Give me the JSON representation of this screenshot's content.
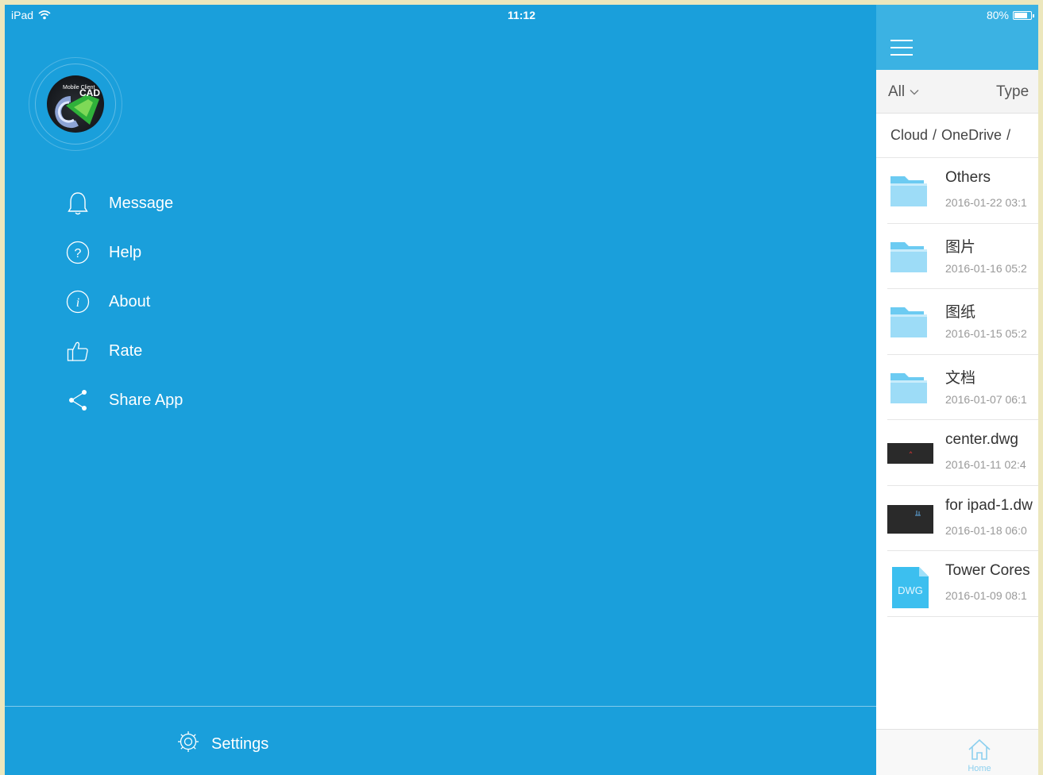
{
  "status_bar": {
    "device": "iPad",
    "time": "11:12",
    "battery": "80%",
    "battery_level": 0.8
  },
  "app_logo": {
    "top_text": "Mobile Client",
    "cad_text": "CAD"
  },
  "menu": {
    "items": [
      {
        "label": "Message",
        "icon": "bell-icon"
      },
      {
        "label": "Help",
        "icon": "help-icon"
      },
      {
        "label": "About",
        "icon": "info-icon"
      },
      {
        "label": "Rate",
        "icon": "thumbs-up-icon"
      },
      {
        "label": "Share App",
        "icon": "share-icon"
      }
    ]
  },
  "settings": {
    "label": "Settings",
    "icon": "gear-icon"
  },
  "panel": {
    "filter": {
      "all_label": "All",
      "type_label": "Type"
    },
    "breadcrumb": [
      "Cloud",
      "OneDrive"
    ],
    "files": [
      {
        "name": "Others",
        "date": "2016-01-22 03:1",
        "kind": "folder"
      },
      {
        "name": "图片",
        "date": "2016-01-16 05:2",
        "kind": "folder"
      },
      {
        "name": "图纸",
        "date": "2016-01-15 05:2",
        "kind": "folder"
      },
      {
        "name": "文档",
        "date": "2016-01-07 06:1",
        "kind": "folder"
      },
      {
        "name": "center.dwg",
        "date": "2016-01-11 02:4",
        "kind": "dwg-preview"
      },
      {
        "name": "for ipad-1.dw",
        "date": "2016-01-18 06:0",
        "kind": "dwg-preview"
      },
      {
        "name": "Tower Cores",
        "date": "2016-01-09 08:1",
        "kind": "dwg-icon",
        "badge": "DWG"
      }
    ],
    "tab": {
      "label": "Home",
      "icon": "home-icon"
    }
  },
  "colors": {
    "drawer_bg": "#1a9fdb",
    "panel_header": "#3bb2e3",
    "folder": "#8dd8f5",
    "accent": "#8dd0ef"
  }
}
